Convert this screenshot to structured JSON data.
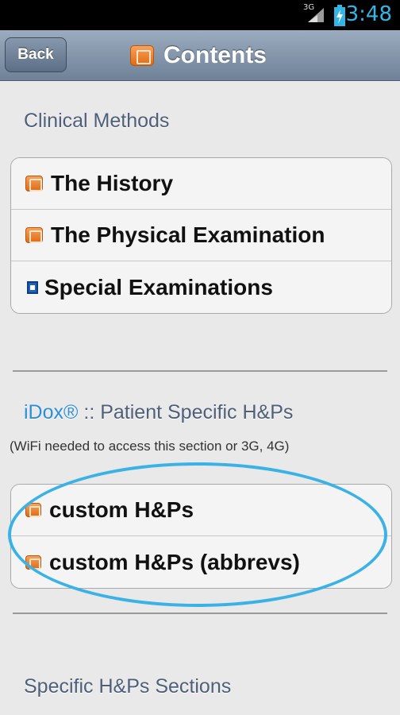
{
  "status_bar": {
    "network": "3G",
    "time": "3:48"
  },
  "navbar": {
    "back_label": "Back",
    "title": "Contents"
  },
  "sections": {
    "clinical": {
      "header": "Clinical Methods",
      "items": [
        {
          "label": "The History",
          "icon": "book-icon"
        },
        {
          "label": "The Physical Examination",
          "icon": "book-icon"
        },
        {
          "label": "Special Examinations",
          "icon": "square-icon"
        }
      ]
    },
    "idox": {
      "header_brand": "iDox®",
      "header_rest": " :: Patient Specific H&Ps",
      "note": "(WiFi needed to access this section or 3G, 4G)",
      "items": [
        {
          "label": "custom H&Ps",
          "icon": "book-icon"
        },
        {
          "label": "custom H&Ps (abbrevs)",
          "icon": "book-icon"
        }
      ]
    },
    "specific": {
      "header": "Specific H&Ps Sections"
    }
  },
  "colors": {
    "accent_blue": "#2b8ed8",
    "highlight_ellipse": "#3bb2e6",
    "nav_gradient_top": "#9bacbf",
    "nav_gradient_bottom": "#6f8198"
  }
}
